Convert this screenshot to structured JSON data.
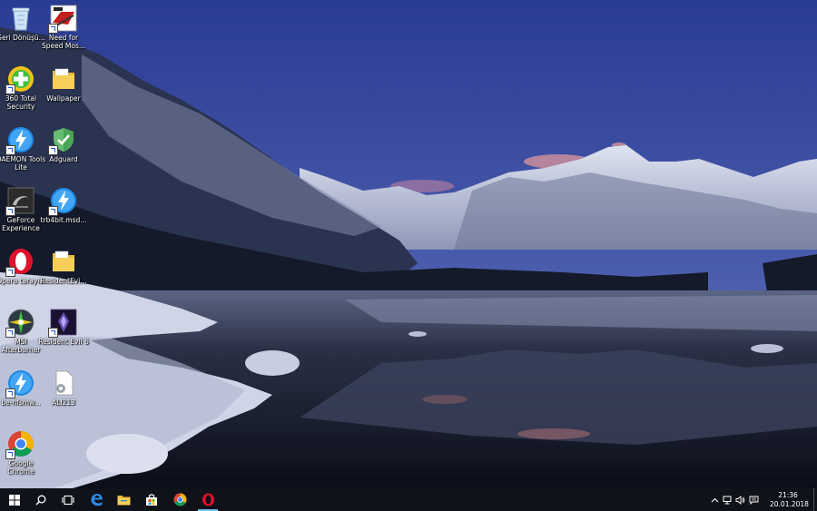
{
  "desktop": {
    "icons": [
      {
        "label": "Geri Dönüşü...",
        "icon": "recycle-bin-icon",
        "shortcut": false
      },
      {
        "label": "Need for Speed Mos...",
        "icon": "nfs-game-icon",
        "shortcut": true
      },
      {
        "label": "360 Total Security",
        "icon": "360-security-icon",
        "shortcut": true
      },
      {
        "label": "Wallpaper",
        "icon": "folder-icon",
        "shortcut": false
      },
      {
        "label": "DAEMON Tools Lite",
        "icon": "daemon-tools-icon",
        "shortcut": true
      },
      {
        "label": "Adguard",
        "icon": "adguard-shield-icon",
        "shortcut": true
      },
      {
        "label": "GeForce Experience",
        "icon": "geforce-icon",
        "shortcut": true
      },
      {
        "label": "trb4bit.msd...",
        "icon": "daemon-tools-icon",
        "shortcut": true
      },
      {
        "label": "Opera tarayıcı",
        "icon": "opera-icon",
        "shortcut": true
      },
      {
        "label": "ResidentEvi...",
        "icon": "folder-icon",
        "shortcut": false
      },
      {
        "label": "MSI Afterburner",
        "icon": "msi-afterburner-icon",
        "shortcut": true
      },
      {
        "label": "Resident Evil 6",
        "icon": "resident-evil-icon",
        "shortcut": true
      },
      {
        "label": "be-nfsmw...",
        "icon": "daemon-tools-icon",
        "shortcut": true
      },
      {
        "label": "ALI213",
        "icon": "settings-file-icon",
        "shortcut": false
      },
      {
        "label": "Google Chrome",
        "icon": "chrome-icon",
        "shortcut": true
      }
    ]
  },
  "taskbar": {
    "buttons": [
      {
        "name": "start-button",
        "icon": "windows-logo-icon"
      },
      {
        "name": "search-button",
        "icon": "search-icon"
      },
      {
        "name": "task-view-button",
        "icon": "task-view-icon"
      },
      {
        "name": "edge-button",
        "icon": "edge-icon"
      },
      {
        "name": "file-explorer-button",
        "icon": "file-explorer-icon"
      },
      {
        "name": "store-button",
        "icon": "store-icon"
      },
      {
        "name": "chrome-button",
        "icon": "chrome-icon"
      },
      {
        "name": "opera-button",
        "icon": "opera-icon"
      }
    ],
    "tray": {
      "icons": [
        "chevron-up-icon",
        "network-icon",
        "volume-icon",
        "notification-icon"
      ],
      "time": "21:36",
      "date": "20.01.2018"
    }
  },
  "colors": {
    "taskbar": "#10121a",
    "accent": "#76b9ed"
  }
}
